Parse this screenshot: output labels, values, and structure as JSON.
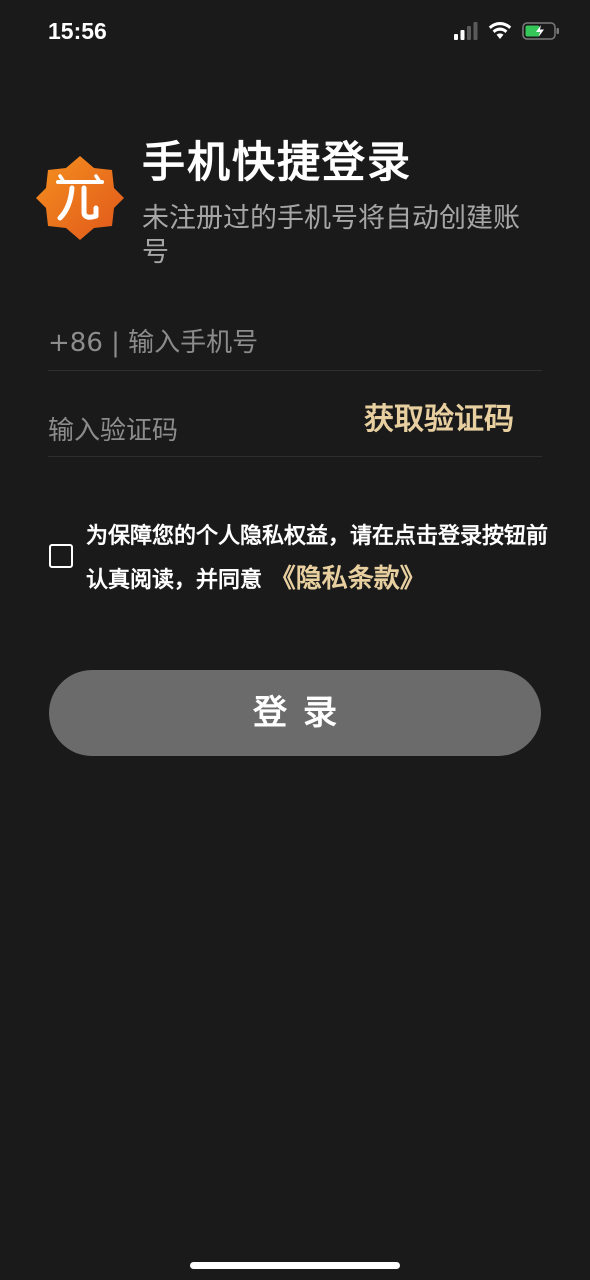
{
  "status_bar": {
    "time": "15:56"
  },
  "header": {
    "title": "手机快捷登录",
    "subtitle": "未注册过的手机号将自动创建账号"
  },
  "phone_field": {
    "placeholder": "+86 | 输入手机号",
    "value": ""
  },
  "code_field": {
    "placeholder": "输入验证码",
    "value": ""
  },
  "get_code_label": "获取验证码",
  "agreement": {
    "checked": false,
    "text": "为保障您的个人隐私权益，请在点击登录按钮前认真阅读，并同意",
    "link_text": "《隐私条款》"
  },
  "login_label": "登录",
  "colors": {
    "background": "#1a1a1a",
    "accent_gold": "#e8cfa0",
    "logo_orange": "#f07a1a",
    "button_gray": "#6b6b6b"
  },
  "icons": {
    "logo": "app-logo-icon",
    "signal": "cellular-signal-icon",
    "wifi": "wifi-icon",
    "battery": "battery-charging-icon"
  }
}
